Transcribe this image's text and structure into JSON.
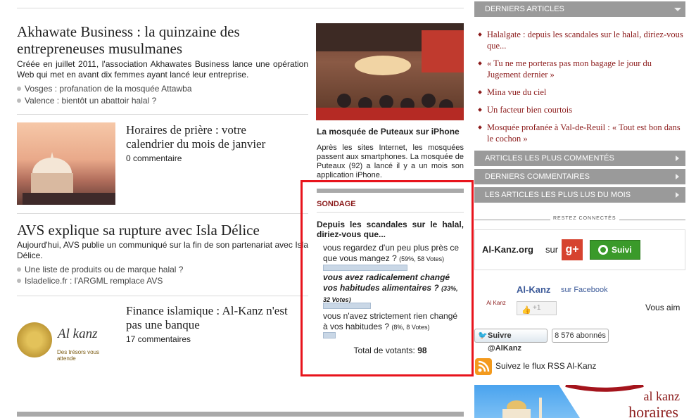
{
  "articles": {
    "a1": {
      "title": "Akhawate Business : la quinzaine des entrepreneuses musulmanes",
      "excerpt": "Créée en juillet 2011, l'association Akhawates Business lance une opération Web qui met en avant dix femmes ayant lancé leur entreprise.",
      "related": [
        "Vosges : profanation de la mosquée Attawba",
        "Valence : bientôt un abattoir halal ?"
      ]
    },
    "a2": {
      "title": "Horaires de prière : votre calendrier du mois de janvier",
      "comments": "0 commentaire"
    },
    "a3": {
      "title": "AVS explique sa rupture avec Isla Délice",
      "excerpt": "Aujourd'hui, AVS publie un communiqué sur la fin de son partenariat avec Isla Délice.",
      "related": [
        "Une liste de produits ou de marque halal ?",
        "Isladelice.fr : l'ARGML remplace AVS"
      ]
    },
    "a4": {
      "title": "Finance islamique : Al-Kanz n'est pas une banque",
      "comments": "17 commentaires",
      "logo_text": "Al kanz",
      "logo_tagline": "Des trésors vous attende"
    },
    "feature": {
      "title": "La mosquée de Puteaux sur iPhone",
      "excerpt": "Après les sites Internet, les mosquées passent aux smartphones. La mosquée de Puteaux (92) a lancé il y a un mois son application iPhone."
    }
  },
  "poll": {
    "heading": "SONDAGE",
    "question": "Depuis les scandales sur le halal, diriez-vous que...",
    "options": [
      {
        "text": "vous regardez d'un peu plus près ce que vous mangez ?",
        "meta": "(59%, 58 Votes)",
        "percent": 59,
        "bold": false
      },
      {
        "text": "vous avez radicalement changé vos habitudes alimentaires ?",
        "meta": "(33%, 32 Votes)",
        "percent": 33,
        "bold": true
      },
      {
        "text": "vous n'avez strictement rien changé à vos habitudes ?",
        "meta": "(8%, 8 Votes)",
        "percent": 8,
        "bold": false
      }
    ],
    "total_label": "Total de votants:",
    "total_value": "98"
  },
  "sidebar": {
    "latest_header": "DERNIERS ARTICLES",
    "latest": [
      "Halalgate : depuis les scandales sur le halal, diriez-vous que...",
      "« Tu ne me porteras pas mon bagage le jour du Jugement dernier »",
      "Mina vue du ciel",
      "Un facteur bien courtois",
      "Mosquée profanée à Val-de-Reuil : « Tout est bon dans le cochon »"
    ],
    "tabs": [
      "ARTICLES LES PLUS COMMENTÉS",
      "DERNIERS COMMENTAIRES",
      "LES ARTICLES LES PLUS LUS DU MOIS"
    ],
    "connect_label": "RESTEZ CONNECTÉS",
    "gplus": {
      "site": "Al-Kanz.org",
      "on": "sur",
      "follow": "Suivi"
    },
    "facebook": {
      "name": "Al-Kanz",
      "on": "sur Facebook",
      "like": "+1",
      "you_like": "Vous aim",
      "logo": "Al Kanz"
    },
    "twitter": {
      "follow": "Suivre @AlKanz",
      "count": "8 576 abonnés"
    },
    "rss": "Suivez le flux RSS Al-Kanz",
    "banner": {
      "brand": "al kanz",
      "word": "horaires"
    }
  },
  "colors": {
    "accent": "#8b1a1a",
    "highlight": "#e8141c",
    "sidebar_bar": "#9a9a9a"
  }
}
